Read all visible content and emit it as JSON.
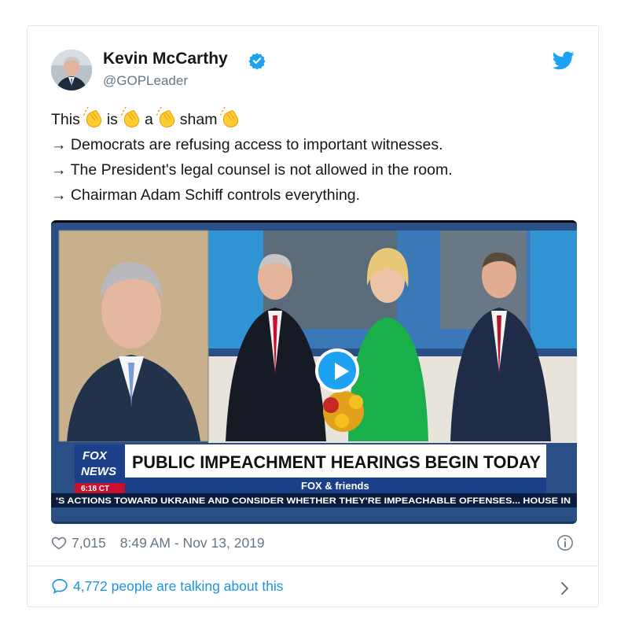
{
  "tweet": {
    "author_name": "Kevin McCarthy",
    "handle": "@GOPLeader",
    "lines": {
      "first_words": [
        "This",
        "is",
        "a",
        "sham"
      ],
      "bullet_1": "→ Democrats are refusing access to important witnesses.",
      "bullet_2": "→ The President's legal counsel is not allowed in the room.",
      "bullet_3": "→ Chairman Adam Schiff controls everything."
    },
    "likes": "7,015",
    "timestamp": "8:49 AM - Nov 13, 2019",
    "talking": "4,772 people are talking about this"
  },
  "video": {
    "chyron_headline": "PUBLIC IMPEACHMENT HEARINGS BEGIN TODAY",
    "network_logo_top": "FOX",
    "network_logo_bottom": "NEWS",
    "clock": "6:18 CT",
    "show_name": "FOX & friends",
    "ticker": "'S ACTIONS TOWARD UKRAINE AND CONSIDER WHETHER THEY'RE IMPEACHABLE OFFENSES... HOUSE IN"
  },
  "icons": {
    "verified": "verified-badge-icon",
    "bird": "twitter-bird-icon",
    "clap": "clapping-hands-emoji",
    "play": "play-icon",
    "heart": "heart-icon",
    "info": "info-icon",
    "bubble": "speech-bubble-icon",
    "chevron": "chevron-right-icon"
  },
  "colors": {
    "accent": "#1da1f2",
    "link": "#1b95e0",
    "muted": "#657786",
    "text": "#14171a",
    "chyron_blue": "#1c3f8a"
  }
}
